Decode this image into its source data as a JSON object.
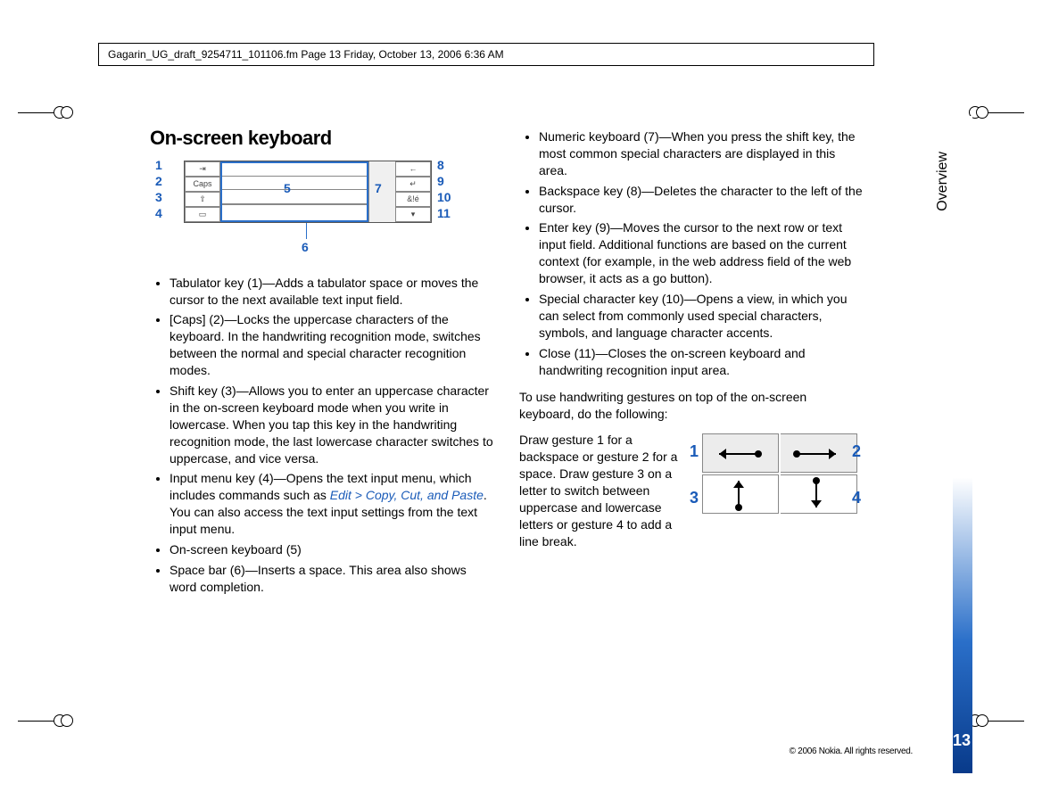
{
  "docFooter": "Gagarin_UG_draft_9254711_101106.fm  Page 13  Friday, October 13, 2006  6:36 AM",
  "sidebar": {
    "section": "Overview",
    "pageNumber": "13"
  },
  "copyright": "© 2006 Nokia. All rights reserved.",
  "heading": "On-screen keyboard",
  "kbd": {
    "callouts": [
      "1",
      "2",
      "3",
      "4",
      "5",
      "6",
      "7",
      "8",
      "9",
      "10",
      "11"
    ],
    "leftKeys": [
      "⇥",
      "Caps",
      "⇧",
      "▭"
    ],
    "rightKeys": [
      "←",
      "↵",
      "&!é",
      "▾"
    ]
  },
  "leftBullets": [
    {
      "pre": "Tabulator key (1)—Adds a tabulator space or moves the cursor to the next available text input field.",
      "menu": null
    },
    {
      "pre": "[Caps] (2)—Locks the uppercase characters of the keyboard. In the handwriting recognition mode, switches between the normal and special character recognition modes.",
      "menu": null
    },
    {
      "pre": "Shift key (3)—Allows you to enter an uppercase character in the on-screen keyboard mode when you write in lowercase. When you tap this key in the handwriting recognition mode, the last lowercase character switches to uppercase, and vice versa.",
      "menu": null
    },
    {
      "pre": "Input menu key (4)—Opens the text input menu, which includes commands such as ",
      "menu": "Edit > Copy, Cut, and Paste",
      "post": ". You can also access the text input settings from the text input menu."
    },
    {
      "pre": "On-screen keyboard (5)",
      "menu": null
    },
    {
      "pre": "Space bar (6)—Inserts a space. This area also shows word completion.",
      "menu": null
    }
  ],
  "rightBullets": [
    "Numeric keyboard (7)—When you press the shift key, the most common special characters are displayed in this area.",
    "Backspace key (8)—Deletes the character to the left of the cursor.",
    "Enter key (9)—Moves the cursor to the next row or text input field. Additional functions are based on the current context (for example, in the web address field of the web browser, it acts as a go button).",
    "Special character key (10)—Opens a view, in which you can select from commonly used special characters, symbols, and language character accents.",
    "Close (11)—Closes the on-screen keyboard and handwriting recognition input area."
  ],
  "gestureIntro": "To use handwriting gestures on top of the on-screen keyboard, do the following:",
  "gestureBody": "Draw gesture 1 for a backspace or gesture 2 for a space. Draw gesture 3 on a letter to switch between uppercase and lowercase letters or gesture 4 to add a line break.",
  "gestureLabels": [
    "1",
    "2",
    "3",
    "4"
  ]
}
